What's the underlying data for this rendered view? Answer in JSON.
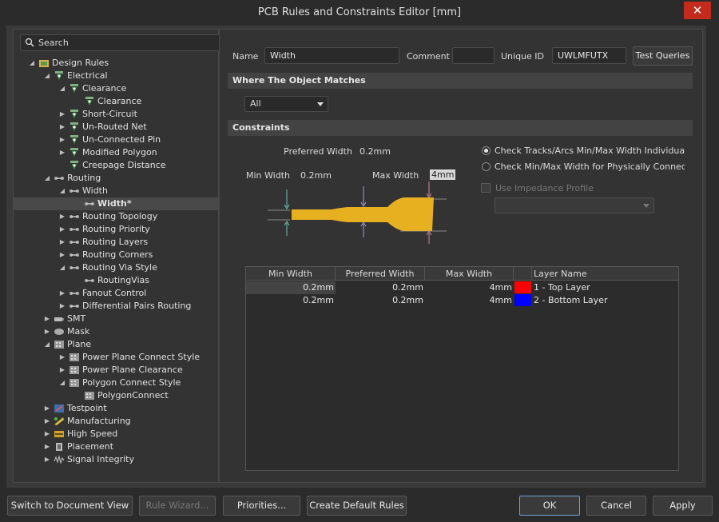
{
  "window": {
    "title": "PCB Rules and Constraints Editor [mm]",
    "close_glyph": "✕"
  },
  "search": {
    "label": "Search"
  },
  "tree": [
    {
      "label": "Design Rules",
      "icon": "design-rules-icon",
      "expanded": true
    },
    {
      "label": "Electrical",
      "icon": "rule-icon",
      "expanded": true
    },
    {
      "label": "Clearance",
      "icon": "rule-icon",
      "expanded": true
    },
    {
      "label": "Clearance",
      "icon": "rule-icon"
    },
    {
      "label": "Short-Circuit",
      "icon": "rule-icon",
      "expanded": false
    },
    {
      "label": "Un-Routed Net",
      "icon": "rule-icon",
      "expanded": false
    },
    {
      "label": "Un-Connected Pin",
      "icon": "rule-icon",
      "expanded": false
    },
    {
      "label": "Modified Polygon",
      "icon": "rule-icon",
      "expanded": false
    },
    {
      "label": "Creepage Distance",
      "icon": "rule-icon"
    },
    {
      "label": "Routing",
      "icon": "routing-icon",
      "expanded": true
    },
    {
      "label": "Width",
      "icon": "routing-icon",
      "expanded": true
    },
    {
      "label": "Width*",
      "icon": "routing-icon",
      "selected": true
    },
    {
      "label": "Routing Topology",
      "icon": "routing-icon",
      "expanded": false
    },
    {
      "label": "Routing Priority",
      "icon": "routing-icon",
      "expanded": false
    },
    {
      "label": "Routing Layers",
      "icon": "routing-icon",
      "expanded": false
    },
    {
      "label": "Routing Corners",
      "icon": "routing-icon",
      "expanded": false
    },
    {
      "label": "Routing Via Style",
      "icon": "routing-icon",
      "expanded": true
    },
    {
      "label": "RoutingVias",
      "icon": "routing-icon"
    },
    {
      "label": "Fanout Control",
      "icon": "routing-icon",
      "expanded": false
    },
    {
      "label": "Differential Pairs Routing",
      "icon": "routing-icon",
      "expanded": false
    },
    {
      "label": "SMT",
      "icon": "smt-icon",
      "expanded": false
    },
    {
      "label": "Mask",
      "icon": "mask-icon",
      "expanded": false
    },
    {
      "label": "Plane",
      "icon": "plane-icon",
      "expanded": true
    },
    {
      "label": "Power Plane Connect Style",
      "icon": "plane-icon",
      "expanded": false
    },
    {
      "label": "Power Plane Clearance",
      "icon": "plane-icon",
      "expanded": false
    },
    {
      "label": "Polygon Connect Style",
      "icon": "plane-icon",
      "expanded": true
    },
    {
      "label": "PolygonConnect",
      "icon": "plane-icon"
    },
    {
      "label": "Testpoint",
      "icon": "testpoint-icon",
      "expanded": false
    },
    {
      "label": "Manufacturing",
      "icon": "manufacturing-icon",
      "expanded": false
    },
    {
      "label": "High Speed",
      "icon": "high-speed-icon",
      "expanded": false
    },
    {
      "label": "Placement",
      "icon": "placement-icon",
      "expanded": false
    },
    {
      "label": "Signal Integrity",
      "icon": "signal-integrity-icon",
      "expanded": false
    }
  ],
  "rule": {
    "name_label": "Name",
    "name_value": "Width",
    "comment_label": "Comment",
    "comment_value": "",
    "uid_label": "Unique ID",
    "uid_value": "UWLMFUTX",
    "test_queries": "Test Queries"
  },
  "where": {
    "header": "Where The Object Matches",
    "selected": "All"
  },
  "constraints": {
    "header": "Constraints",
    "preferred_label": "Preferred Width",
    "preferred_value": "0.2mm",
    "min_label": "Min Width",
    "min_value": "0.2mm",
    "max_label": "Max Width",
    "max_value": "4mm",
    "radio1": "Check Tracks/Arcs Min/Max Width Individually",
    "radio2": "Check Min/Max Width for Physically Connected Copper",
    "selected_radio": 1,
    "impedance_label": "Use Impedance Profile",
    "track_color": "#e6b020"
  },
  "grid": {
    "headers": [
      "Min Width",
      "Preferred Width",
      "Max Width",
      "",
      "Layer Name"
    ],
    "rows": [
      {
        "min": "0.2mm",
        "pref": "0.2mm",
        "max": "4mm",
        "color": "#ff0000",
        "layer": "1 - Top Layer"
      },
      {
        "min": "0.2mm",
        "pref": "0.2mm",
        "max": "4mm",
        "color": "#0000ff",
        "layer": "2 - Bottom Layer"
      }
    ]
  },
  "buttons": {
    "switch": "Switch to Document View",
    "wizard": "Rule Wizard...",
    "priorities": "Priorities...",
    "defaults": "Create Default Rules",
    "ok": "OK",
    "cancel": "Cancel",
    "apply": "Apply"
  }
}
